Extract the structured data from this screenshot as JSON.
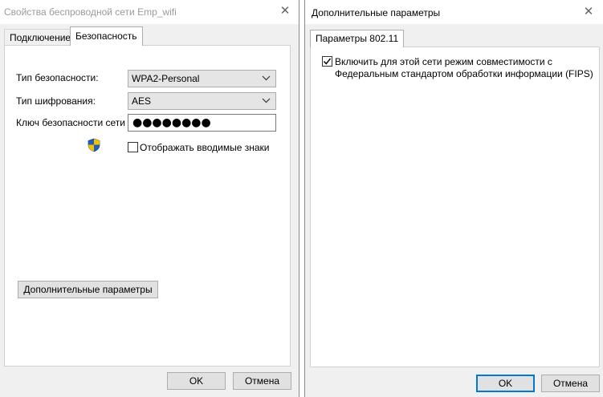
{
  "left_dialog": {
    "title": "Свойства беспроводной сети Emp_wifi",
    "close_glyph": "✕",
    "tabs": [
      "Подключение",
      "Безопасность"
    ],
    "security_type_label": "Тип безопасности:",
    "security_type_value": "WPA2-Personal",
    "encryption_type_label": "Тип шифрования:",
    "encryption_type_value": "AES",
    "network_key_label": "Ключ безопасности сети",
    "network_key_value": "●●●●●●●●",
    "show_chars_label": "Отображать вводимые знаки",
    "show_chars_checked": false,
    "advanced_button": "Дополнительные параметры",
    "ok_button": "OK",
    "cancel_button": "Отмена",
    "icons": [
      "shield-icon",
      "chevron-down-icon",
      "close-icon"
    ]
  },
  "right_dialog": {
    "title": "Дополнительные параметры",
    "close_glyph": "✕",
    "tab": "Параметры 802.11",
    "fips_line1": "Включить для этой сети режим совместимости с",
    "fips_line2": "Федеральным стандартом обработки информации (FIPS)",
    "fips_checked": true,
    "ok_button": "OK",
    "cancel_button": "Отмена"
  },
  "colors": {
    "dialog_bg": "#f0f0f0",
    "panel_bg": "#ffffff",
    "focus_border": "#0078d7",
    "title_inactive": "#9a9a9a"
  }
}
